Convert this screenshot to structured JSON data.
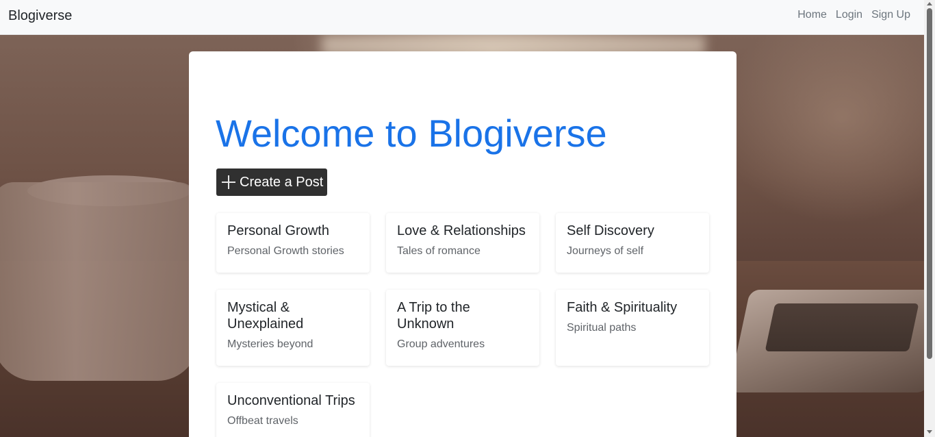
{
  "navbar": {
    "brand": "Blogiverse",
    "links": [
      "Home",
      "Login",
      "Sign Up"
    ]
  },
  "main": {
    "title": "Welcome to Blogiverse",
    "create_button": "Create a Post",
    "categories": [
      {
        "title": "Personal Growth",
        "description": "Personal Growth stories"
      },
      {
        "title": "Love & Relationships",
        "description": "Tales of romance"
      },
      {
        "title": "Self Discovery",
        "description": "Journeys of self"
      },
      {
        "title": "Mystical & Unexplained",
        "description": "Mysteries beyond"
      },
      {
        "title": "A Trip to the Unknown",
        "description": "Group adventures"
      },
      {
        "title": "Faith & Spirituality",
        "description": "Spiritual paths"
      },
      {
        "title": "Unconventional Trips",
        "description": "Offbeat travels"
      }
    ]
  },
  "colors": {
    "accent": "#1a73e8",
    "button_bg": "#303030",
    "navbar_bg": "#f8f9fa"
  }
}
